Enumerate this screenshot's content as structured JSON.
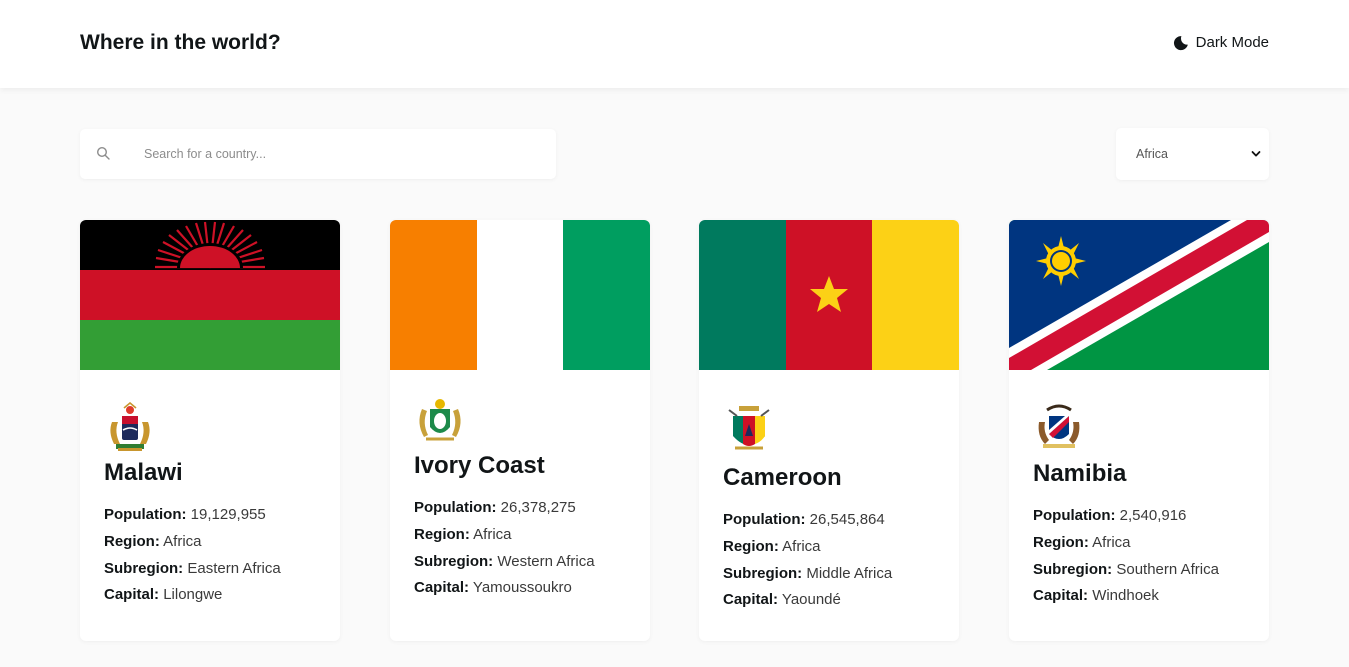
{
  "header": {
    "title": "Where in the world?",
    "dark_mode_label": "Dark Mode"
  },
  "search": {
    "placeholder": "Search for a country...",
    "value": ""
  },
  "filter": {
    "selected": "Africa"
  },
  "labels": {
    "population": "Population:",
    "region": "Region:",
    "subregion": "Subregion:",
    "capital": "Capital:"
  },
  "countries": [
    {
      "name": "Malawi",
      "population": "19,129,955",
      "region": "Africa",
      "subregion": "Eastern Africa",
      "capital": "Lilongwe"
    },
    {
      "name": "Ivory Coast",
      "population": "26,378,275",
      "region": "Africa",
      "subregion": "Western Africa",
      "capital": "Yamoussoukro"
    },
    {
      "name": "Cameroon",
      "population": "26,545,864",
      "region": "Africa",
      "subregion": "Middle Africa",
      "capital": "Yaoundé"
    },
    {
      "name": "Namibia",
      "population": "2,540,916",
      "region": "Africa",
      "subregion": "Southern Africa",
      "capital": "Windhoek"
    }
  ],
  "colors": {
    "background": "#fafafa",
    "card": "#ffffff",
    "text": "#111517"
  }
}
